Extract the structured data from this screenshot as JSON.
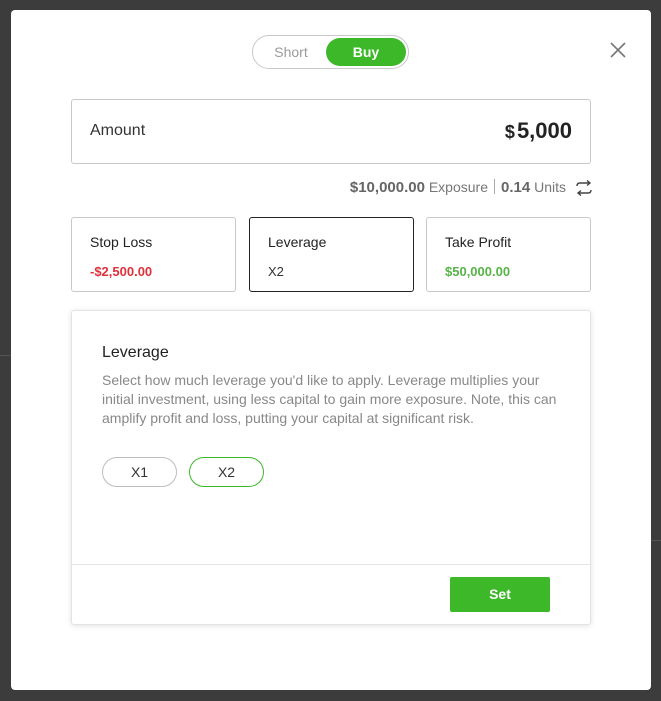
{
  "colors": {
    "accent": "#3cb829",
    "negative": "#e0303b",
    "positive": "#56b447"
  },
  "toggle": {
    "short_label": "Short",
    "buy_label": "Buy",
    "selected": "Buy"
  },
  "close_icon": "close-icon",
  "amount": {
    "label": "Amount",
    "currency": "$",
    "value": "5,000"
  },
  "exposure": {
    "value": "$10,000.00",
    "label": "Exposure",
    "units_value": "0.14",
    "units_label": "Units",
    "swap_icon": "swap-icon"
  },
  "cards": {
    "stop_loss": {
      "title": "Stop Loss",
      "value": "-$2,500.00"
    },
    "leverage": {
      "title": "Leverage",
      "value": "X2"
    },
    "take_profit": {
      "title": "Take Profit",
      "value": "$50,000.00"
    }
  },
  "leverage_panel": {
    "title": "Leverage",
    "description": "Select how much leverage you'd like to apply. Leverage multiplies your initial investment, using less capital to gain more exposure. Note, this can amplify profit and loss, putting your capital at significant risk.",
    "options": [
      "X1",
      "X2"
    ],
    "selected": "X2",
    "set_label": "Set"
  }
}
